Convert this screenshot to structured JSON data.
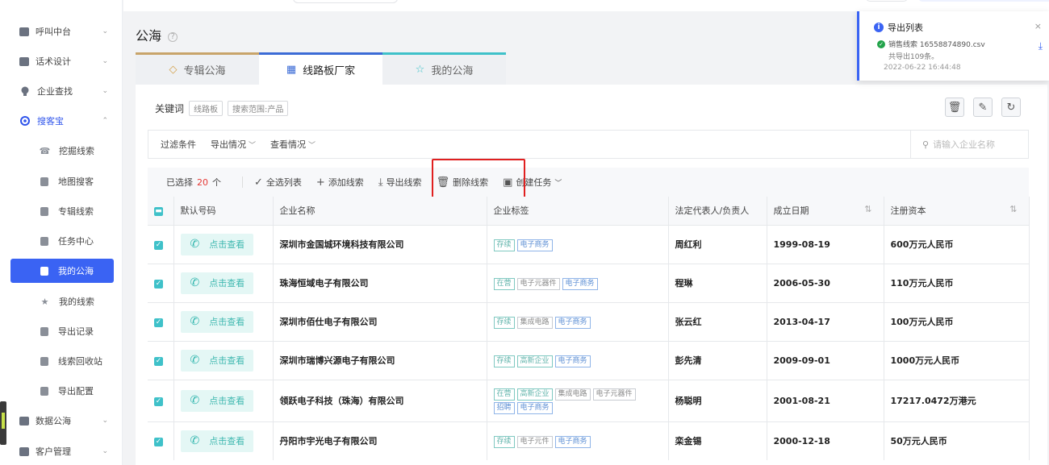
{
  "sidebar": {
    "items": [
      {
        "label": "呼叫中台",
        "icon": "monitor-icon",
        "chev": "⌄"
      },
      {
        "label": "话术设计",
        "icon": "script-icon",
        "chev": "⌄"
      },
      {
        "label": "企业查找",
        "icon": "bulb-icon",
        "chev": "⌄"
      },
      {
        "label": "搜客宝",
        "icon": "search-icon",
        "chev": "⌃"
      },
      {
        "label": "挖掘线索",
        "icon": "mine-icon"
      },
      {
        "label": "地图搜客",
        "icon": "map-icon"
      },
      {
        "label": "专辑线索",
        "icon": "album-icon"
      },
      {
        "label": "任务中心",
        "icon": "task-icon"
      },
      {
        "label": "我的公海",
        "icon": "sea-icon"
      },
      {
        "label": "我的线索",
        "icon": "star-icon"
      },
      {
        "label": "导出记录",
        "icon": "export-record-icon"
      },
      {
        "label": "线索回收站",
        "icon": "trash-icon"
      },
      {
        "label": "导出配置",
        "icon": "export-config-icon"
      },
      {
        "label": "数据公海",
        "icon": "data-icon",
        "chev": "⌄"
      },
      {
        "label": "客户管理",
        "icon": "customer-icon",
        "chev": "⌄"
      }
    ]
  },
  "page": {
    "title": "公海",
    "help": "?"
  },
  "tabs": [
    {
      "label": "专辑公海",
      "icon": "diamond-icon"
    },
    {
      "label": "线路板厂家",
      "icon": "building-icon"
    },
    {
      "label": "我的公海",
      "icon": "star-outline-icon"
    }
  ],
  "keywords": {
    "label": "关键词",
    "tags": [
      "线路板",
      "搜索范围:产品"
    ]
  },
  "toolbar": {
    "delete_icon": "🗑",
    "edit_icon": "✎",
    "refresh_icon": "↻"
  },
  "filters": {
    "filter_label": "过滤条件",
    "export_status": "导出情况",
    "view_status": "查看情况",
    "search_placeholder": "请输入企业名称"
  },
  "actions": {
    "selected_prefix": "已选择",
    "selected_count": "20",
    "selected_suffix": "个",
    "select_all": "全选列表",
    "add_leads": "添加线索",
    "export_leads": "导出线索",
    "delete_leads": "删除线索",
    "create_task": "创建任务"
  },
  "table": {
    "headers": [
      "默认号码",
      "企业名称",
      "企业标签",
      "法定代表人/负责人",
      "成立日期",
      "注册资本"
    ],
    "call_label": "点击查看",
    "rows": [
      {
        "company": "深圳市金国城环境科技有限公司",
        "tags": [
          [
            "存续",
            "green"
          ],
          [
            "电子商务",
            "blue"
          ]
        ],
        "rep": "周红利",
        "date": "1999-08-19",
        "capital": "600万元人民币"
      },
      {
        "company": "珠海恒域电子有限公司",
        "tags": [
          [
            "在营",
            "green"
          ],
          [
            "电子元器件",
            "gray"
          ],
          [
            "电子商务",
            "blue"
          ]
        ],
        "rep": "程琳",
        "date": "2006-05-30",
        "capital": "110万元人民币"
      },
      {
        "company": "深圳市佰仕电子有限公司",
        "tags": [
          [
            "存续",
            "green"
          ],
          [
            "集成电路",
            "gray"
          ],
          [
            "电子商务",
            "blue"
          ]
        ],
        "rep": "张云红",
        "date": "2013-04-17",
        "capital": "100万元人民币"
      },
      {
        "company": "深圳市瑞博兴源电子有限公司",
        "tags": [
          [
            "存续",
            "green"
          ],
          [
            "高新企业",
            "green"
          ],
          [
            "电子商务",
            "blue"
          ]
        ],
        "rep": "彭先清",
        "date": "2009-09-01",
        "capital": "1000万元人民币"
      },
      {
        "company": "领跃电子科技（珠海）有限公司",
        "tags": [
          [
            "在营",
            "green"
          ],
          [
            "高新企业",
            "green"
          ],
          [
            "集成电路",
            "gray"
          ],
          [
            "电子元器件",
            "gray"
          ],
          [
            "招聘",
            "blue"
          ],
          [
            "电子商务",
            "blue"
          ]
        ],
        "rep": "杨聪明",
        "date": "2001-08-21",
        "capital": "17217.0472万港元"
      },
      {
        "company": "丹阳市宇光电子有限公司",
        "tags": [
          [
            "存续",
            "green"
          ],
          [
            "电子元件",
            "gray"
          ],
          [
            "电子商务",
            "blue"
          ]
        ],
        "rep": "栾金锡",
        "date": "2000-12-18",
        "capital": "50万元人民币"
      }
    ]
  },
  "notification": {
    "title": "导出列表",
    "file": "销售线索 16558874890.csv",
    "count": "共导出109条。",
    "time": "2022-06-22 16:44:48",
    "close": "×",
    "download": "⤓"
  },
  "colors": {
    "accent": "#3a63f3",
    "teal": "#3fc1c9",
    "highlight": "#e02020"
  }
}
